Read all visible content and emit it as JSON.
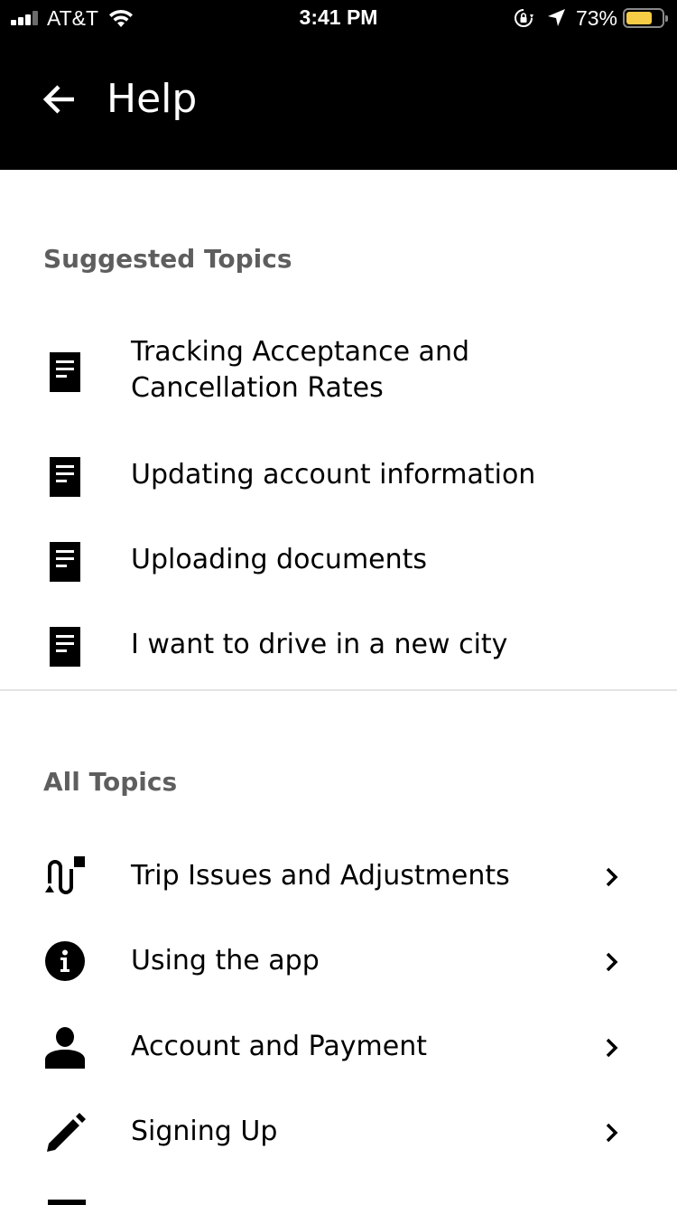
{
  "status_bar": {
    "carrier": "AT&T",
    "time": "3:41 PM",
    "battery_percent": "73%",
    "signal_bars": 3,
    "battery_level": 0.73,
    "battery_color": "#f6cb45"
  },
  "header": {
    "title": "Help",
    "back_icon": "arrow-left-icon"
  },
  "suggested": {
    "heading": "Suggested Topics",
    "items": [
      {
        "label": "Tracking Acceptance and\nCancellation Rates",
        "icon": "document-icon"
      },
      {
        "label": "Updating account information",
        "icon": "document-icon"
      },
      {
        "label": "Uploading documents",
        "icon": "document-icon"
      },
      {
        "label": "I want to drive in a new city",
        "icon": "document-icon"
      }
    ]
  },
  "all_topics": {
    "heading": "All Topics",
    "items": [
      {
        "label": "Trip Issues and Adjustments",
        "icon": "route-icon"
      },
      {
        "label": "Using the app",
        "icon": "info-icon"
      },
      {
        "label": "Account and Payment",
        "icon": "person-icon"
      },
      {
        "label": "Signing Up",
        "icon": "pencil-icon"
      }
    ]
  }
}
